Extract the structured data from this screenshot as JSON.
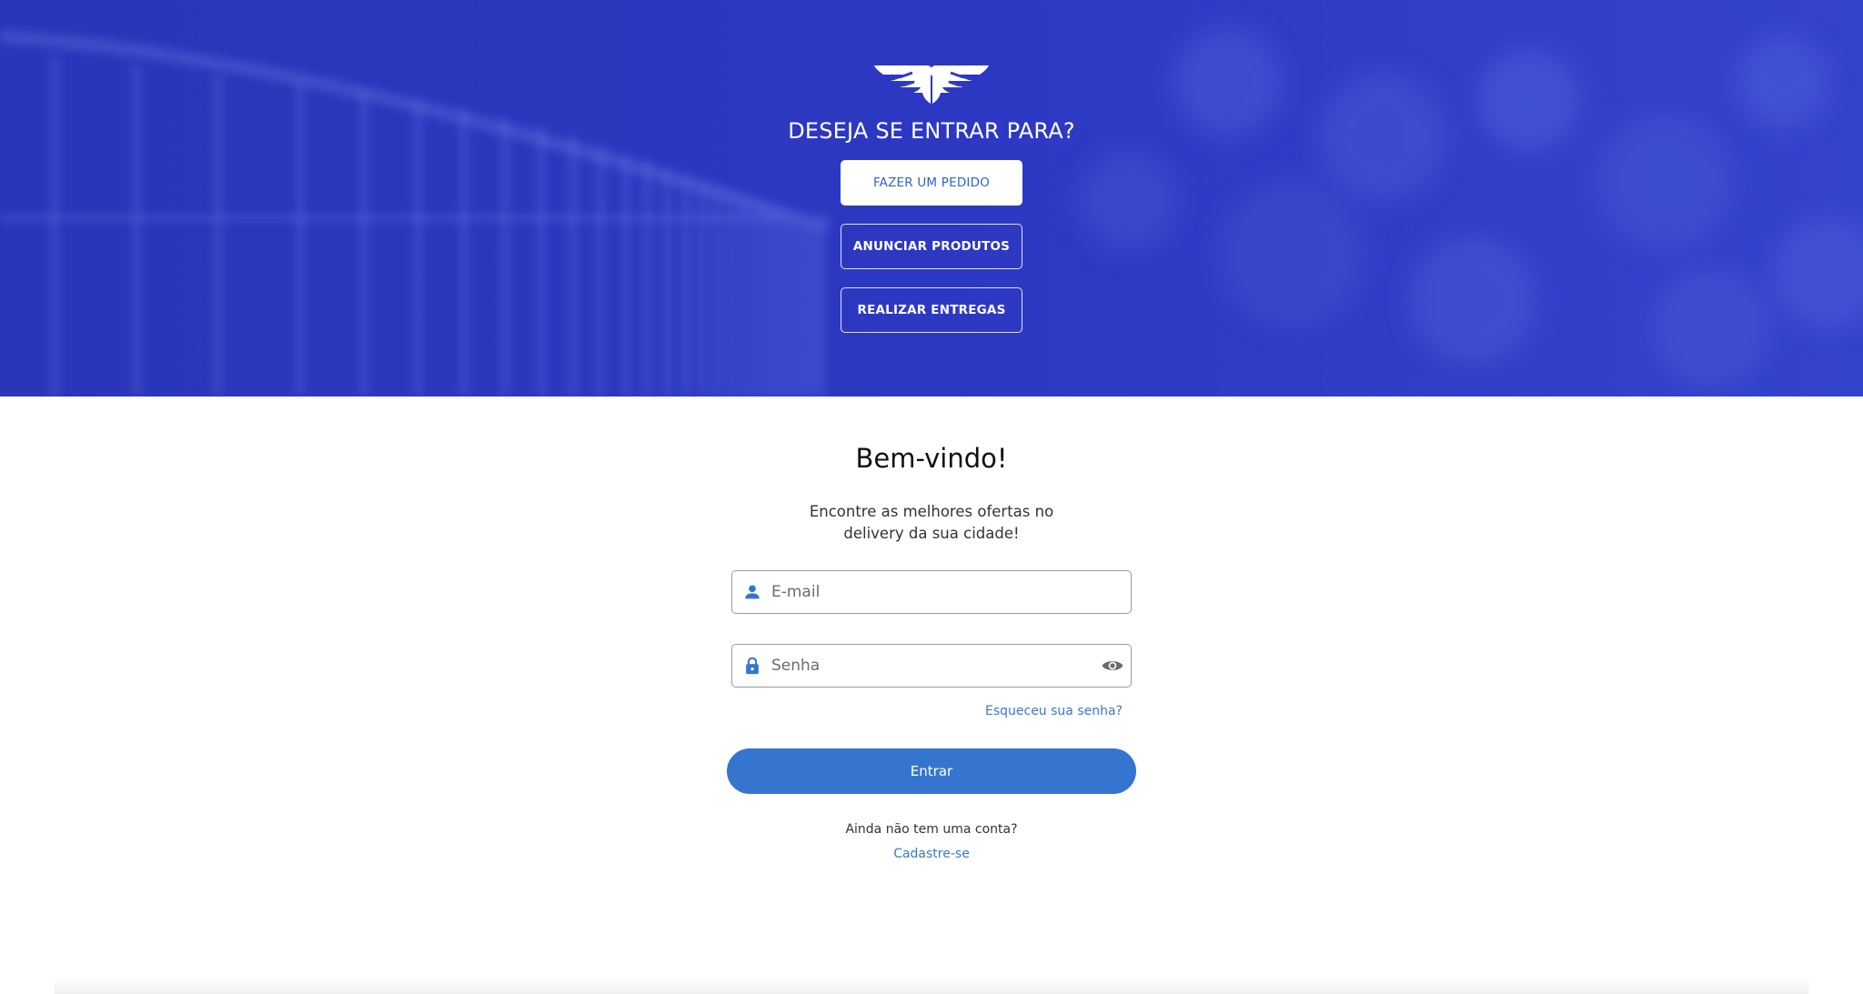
{
  "hero": {
    "logo_icon": "winged-logo-icon",
    "title": "DESEJA SE ENTRAR PARA?",
    "buttons": [
      {
        "label": "FAZER UM PEDIDO",
        "style": "solid"
      },
      {
        "label": "ANUNCIAR PRODUTOS",
        "style": "outline"
      },
      {
        "label": "REALIZAR ENTREGAS",
        "style": "outline"
      }
    ],
    "background_color": "#2e3bc6"
  },
  "login": {
    "title": "Bem-vindo!",
    "tagline": "Encontre as melhores ofertas no delivery da sua cidade!",
    "email": {
      "placeholder": "E-mail",
      "value": "",
      "icon": "user-icon"
    },
    "password": {
      "placeholder": "Senha",
      "value": "",
      "icon": "lock-icon",
      "toggle_icon": "eye-icon"
    },
    "forgot_link": "Esqueceu sua senha?",
    "submit_label": "Entrar",
    "no_account_text": "Ainda não tem uma conta?",
    "signup_link": "Cadastre-se"
  },
  "colors": {
    "accent": "#3675cf",
    "link": "#3a77d0",
    "hero_blue": "#2e3bc6"
  }
}
